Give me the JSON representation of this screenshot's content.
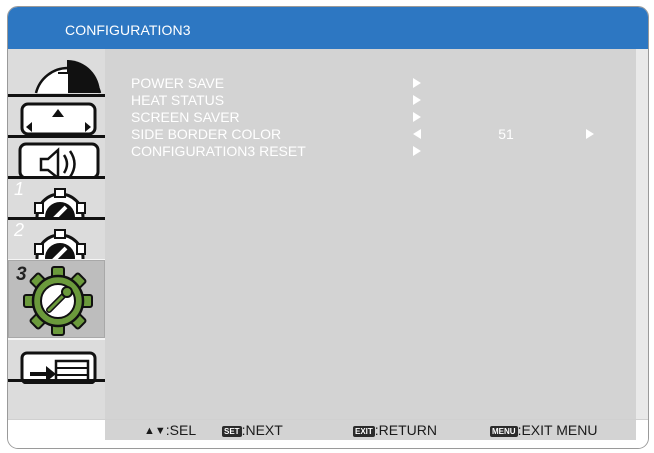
{
  "window": {
    "title": "CONFIGURATION3"
  },
  "sidebar": {
    "tabs": [
      {
        "id": "picture",
        "icon": "picture-icon",
        "number": "",
        "active": false
      },
      {
        "id": "screen",
        "icon": "screen-adjust-icon",
        "number": "",
        "active": false
      },
      {
        "id": "audio",
        "icon": "speaker-icon",
        "number": "",
        "active": false
      },
      {
        "id": "config1",
        "icon": "gear-wrench-icon",
        "number": "1",
        "active": false
      },
      {
        "id": "config2",
        "icon": "gear-wrench-icon",
        "number": "2",
        "active": false
      },
      {
        "id": "config3",
        "icon": "gear-wrench-icon",
        "number": "3",
        "active": true
      },
      {
        "id": "input",
        "icon": "input-source-icon",
        "number": "",
        "active": false
      }
    ]
  },
  "menu": {
    "items": [
      {
        "label": "POWER SAVE",
        "has_submenu": true
      },
      {
        "label": "HEAT STATUS",
        "has_submenu": true
      },
      {
        "label": "SCREEN SAVER",
        "has_submenu": true
      },
      {
        "label": "SIDE BORDER COLOR",
        "value": "51",
        "adjustable": true
      },
      {
        "label": "CONFIGURATION3 RESET",
        "has_submenu": true
      }
    ]
  },
  "footer": {
    "hints": [
      {
        "key": "▲▼",
        "text": ":SEL"
      },
      {
        "key": "SET",
        "text": ":NEXT"
      },
      {
        "key": "EXIT",
        "text": ":RETURN"
      },
      {
        "key": "MENU",
        "text": ":EXIT MENU"
      }
    ]
  },
  "colors": {
    "title_bar": "#2d77c2",
    "content_bg": "#d3d3d3",
    "active_icon": "#6b9a3c",
    "text": "#ffffff"
  }
}
